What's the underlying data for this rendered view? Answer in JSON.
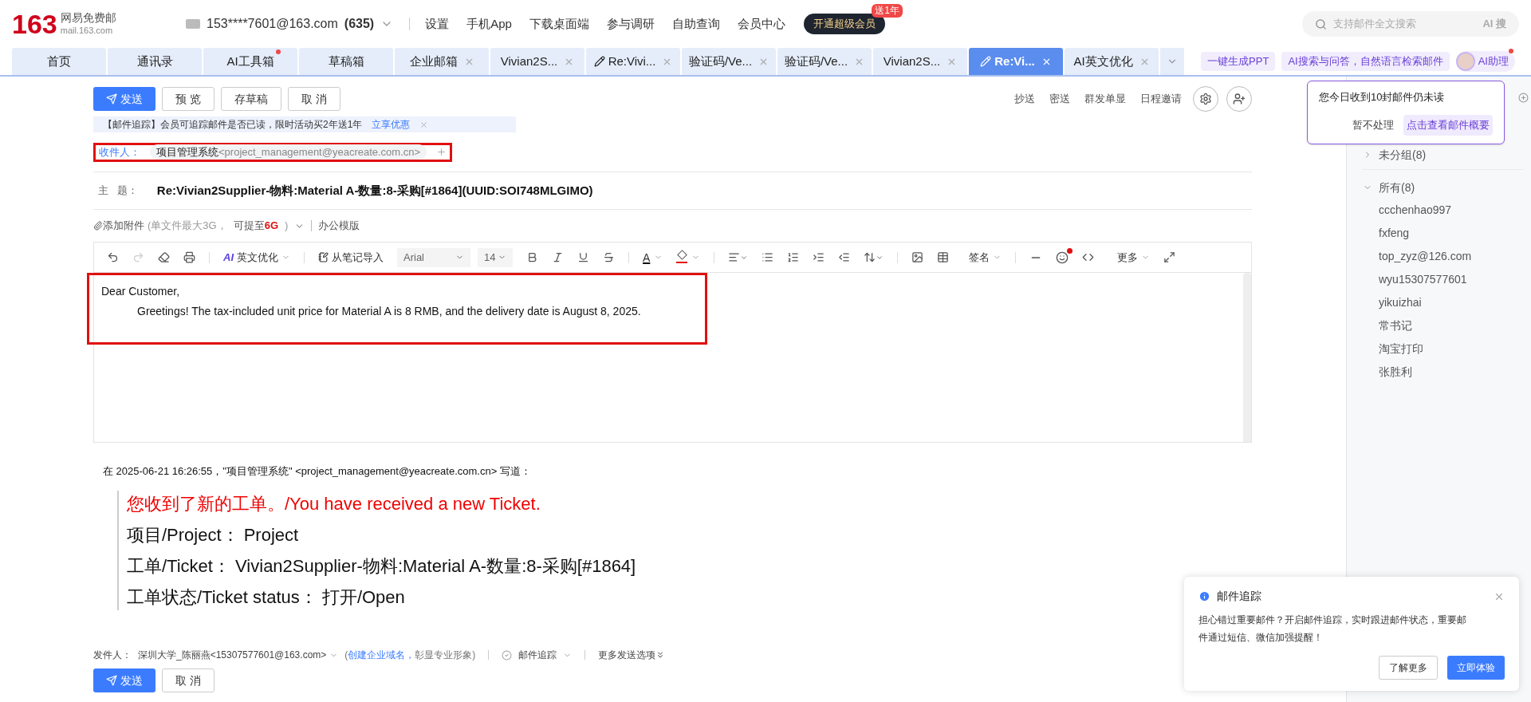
{
  "header": {
    "logo_number": "163",
    "logo_name": "网易免费邮",
    "logo_domain": "mail.163.com",
    "account": "153****7601@163.com",
    "unread": "(635)",
    "nav": [
      "设置",
      "手机App",
      "下载桌面端",
      "参与调研",
      "自助查询",
      "会员中心"
    ],
    "vip_button": "开通超级会员",
    "vip_badge": "送1年",
    "search": {
      "placeholder": "支持邮件全文搜索",
      "ai_label": "AI 搜"
    }
  },
  "tabs": [
    {
      "label": "首页",
      "selected": false,
      "closable": false,
      "draft": false,
      "dot": false
    },
    {
      "label": "通讯录",
      "selected": false,
      "closable": false,
      "draft": false,
      "dot": false
    },
    {
      "label": "AI工具箱",
      "selected": false,
      "closable": false,
      "draft": false,
      "dot": true
    },
    {
      "label": "草稿箱",
      "selected": false,
      "closable": false,
      "draft": false,
      "dot": false
    },
    {
      "label": "企业邮箱",
      "selected": false,
      "closable": true,
      "draft": false,
      "dot": false
    },
    {
      "label": "Vivian2S...",
      "selected": false,
      "closable": true,
      "draft": false,
      "dot": false
    },
    {
      "label": "Re:Vivi...",
      "selected": false,
      "closable": true,
      "draft": true,
      "dot": false
    },
    {
      "label": "验证码/Ve...",
      "selected": false,
      "closable": true,
      "draft": false,
      "dot": false
    },
    {
      "label": "验证码/Ve...",
      "selected": false,
      "closable": true,
      "draft": false,
      "dot": false
    },
    {
      "label": "Vivian2S...",
      "selected": false,
      "closable": true,
      "draft": false,
      "dot": false
    },
    {
      "label": "Re:Vi...",
      "selected": true,
      "closable": true,
      "draft": true,
      "dot": false
    },
    {
      "label": "AI英文优化",
      "selected": false,
      "closable": true,
      "draft": false,
      "dot": false
    }
  ],
  "ai_links": [
    "一键生成PPT",
    "AI搜索与问答，自然语言检索邮件"
  ],
  "ai_assistant": "AI助理",
  "ai_popup": {
    "message": "您今日收到10封邮件仍未读",
    "dismiss": "暂不处理",
    "action": "点击查看邮件概要"
  },
  "compose_actions": [
    "发送",
    "预 览",
    "存草稿",
    "取 消"
  ],
  "compose_options": [
    "抄送",
    "密送",
    "群发单显",
    "日程邀请"
  ],
  "promo": {
    "text": "【邮件追踪】会员可追踪邮件是否已读，限时活动买2年送1年",
    "link": "立享优惠"
  },
  "recipient": {
    "label": "收件人：",
    "name": "项目管理系统",
    "address": "<project_management@yeacreate.com.cn>"
  },
  "subject": {
    "label": "主   题：",
    "value": "Re:Vivian2Supplier-物料:Material A-数量:8-采购[#1864](UUID:SOI748MLGIMO)"
  },
  "attachment": {
    "label": "添加附件",
    "hint": "(单文件最大3G，",
    "upgrade": "可提至",
    "size": "6G",
    "close": ")",
    "template": "办公模版"
  },
  "editor_toolbar": {
    "ai_mark": "AI",
    "text_color": "A",
    "ai_optimize": "英文优化",
    "import": "从笔记导入",
    "font": "Arial",
    "size": "14",
    "signature": "签名",
    "more": "更多"
  },
  "body": {
    "greeting": "Dear Customer,",
    "paragraph": "Greetings! The tax-included unit price for Material A is 8 RMB, and the delivery date is August 8, 2025."
  },
  "quote": {
    "header": "在 2025-06-21 16:26:55，\"项目管理系统\" <project_management@yeacreate.com.cn> 写道：",
    "lines": [
      {
        "text": "您收到了新的工单。/You have received a new Ticket.",
        "kind": "alert"
      },
      {
        "text": "项目/Project：  Project",
        "kind": "plain"
      },
      {
        "text": "工单/Ticket：  Vivian2Supplier-物料:Material A-数量:8-采购[#1864]",
        "kind": "plain"
      },
      {
        "text": "工单状态/Ticket status：  打开/Open",
        "kind": "plain"
      }
    ]
  },
  "footer": {
    "sender_label": "发件人：",
    "sender": "深圳大学_陈丽燕<15307577601@163.com>",
    "domain_open": "(",
    "domain_link": "创建企业域名，",
    "domain_hint": "彰显专业形象)",
    "tracking": "邮件追踪",
    "more": "更多发送选项"
  },
  "bottom_actions": [
    "发送",
    "取 消"
  ],
  "contacts": {
    "groups": [
      {
        "label": "未分组(8)",
        "expanded": false
      },
      {
        "label": "所有(8)",
        "expanded": true,
        "children": [
          "ccchenhao997",
          "fxfeng",
          "top_zyz@126.com",
          "wyu15307577601",
          "yikuizhai",
          "常书记",
          "淘宝打印",
          "张胜利"
        ]
      }
    ]
  },
  "notice": {
    "title": "邮件追踪",
    "text": "担心错过重要邮件？开启邮件追踪，实时跟进邮件状态，重要邮件通过短信、微信加强提醒！",
    "buttons": [
      "了解更多",
      "立即体验"
    ]
  }
}
